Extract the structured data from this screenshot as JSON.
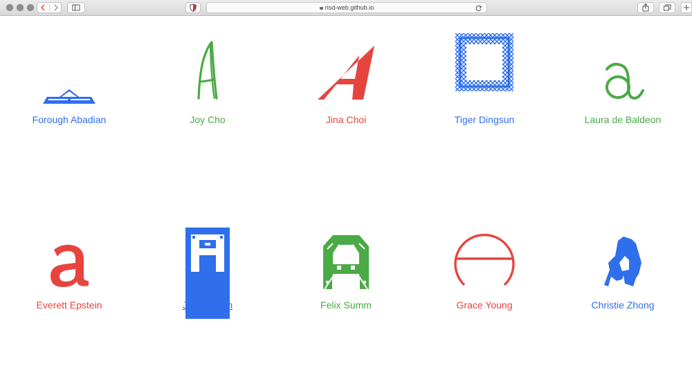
{
  "browser": {
    "url": "risd-web.github.io",
    "icons": [
      "back-icon",
      "forward-icon",
      "sidebar-icon",
      "shield-icon",
      "lock-icon",
      "reload-icon",
      "share-icon",
      "tabs-icon",
      "new-tab-icon"
    ]
  },
  "colors": {
    "blue": "#2f6fec",
    "green": "#4aaa46",
    "red": "#e8443f"
  },
  "students": [
    {
      "name": "Forough Abadian",
      "color": "blue",
      "glyph": "blue-pyramid-a-icon"
    },
    {
      "name": "Joy Cho",
      "color": "green",
      "glyph": "green-handwritten-a-icon"
    },
    {
      "name": "Jina Choi",
      "color": "red",
      "glyph": "red-italic-a-icon"
    },
    {
      "name": "Tiger Dingsun",
      "color": "blue",
      "glyph": "blue-pattern-square-icon"
    },
    {
      "name": "Laura de Baldeon",
      "color": "green",
      "glyph": "green-script-a-icon"
    },
    {
      "name": "Everett Epstein",
      "color": "red",
      "glyph": "red-serif-a-icon"
    },
    {
      "name": "Jueun Jeon",
      "color": "blue",
      "glyph": "blue-block-a-icon",
      "underlined": true
    },
    {
      "name": "Felix Summ",
      "color": "green",
      "glyph": "green-geometric-a-icon"
    },
    {
      "name": "Grace Young",
      "color": "red",
      "glyph": "red-circle-a-icon"
    },
    {
      "name": "Christie Zhong",
      "color": "blue",
      "glyph": "blue-brush-a-icon"
    }
  ]
}
